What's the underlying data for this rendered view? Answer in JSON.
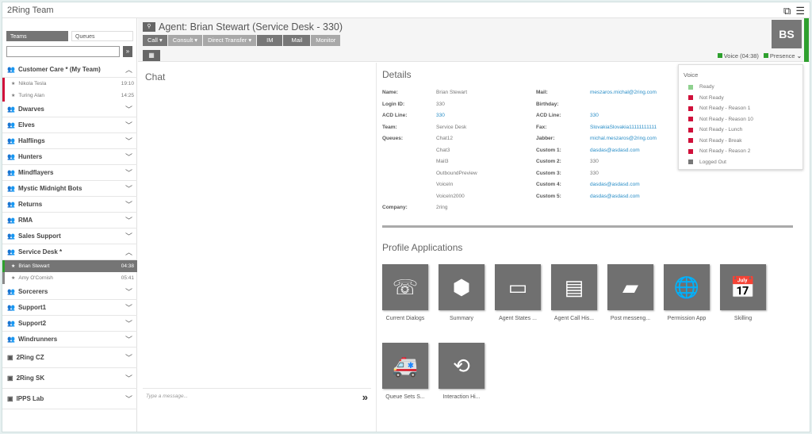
{
  "app": {
    "title": "2Ring Team"
  },
  "sidebar": {
    "tabs": [
      "Teams",
      "Queues"
    ],
    "search": {
      "value": "",
      "placeholder": ""
    },
    "groups": [
      {
        "name": "Customer Care * (My Team)",
        "expanded": true,
        "members": [
          {
            "name": "Nikola Tesla",
            "time": "19:10",
            "status": "#d0103a"
          },
          {
            "name": "Turing Alan",
            "time": "14:25",
            "status": "#d0103a"
          }
        ]
      },
      {
        "name": "Dwarves"
      },
      {
        "name": "Elves"
      },
      {
        "name": "Halflings"
      },
      {
        "name": "Hunters"
      },
      {
        "name": "Mindflayers"
      },
      {
        "name": "Mystic Midnight Bots"
      },
      {
        "name": "Returns"
      },
      {
        "name": "RMA"
      },
      {
        "name": "Sales Support"
      },
      {
        "name": "Service Desk *",
        "expanded": true,
        "members": [
          {
            "name": "Brian Stewart",
            "time": "04:38",
            "status": "#2ea02e",
            "selected": true
          },
          {
            "name": "Amy O'Cornish",
            "time": "05:41",
            "status": "#888888"
          }
        ]
      },
      {
        "name": "Sorcerers"
      },
      {
        "name": "Support1"
      },
      {
        "name": "Support2"
      },
      {
        "name": "Windrunners"
      },
      {
        "name": "2Ring CZ",
        "type": "contact"
      },
      {
        "name": "2Ring SK",
        "type": "contact"
      },
      {
        "name": "IPPS Lab",
        "type": "contact"
      }
    ]
  },
  "header": {
    "agent_title": "Agent: Brian Stewart (Service Desk - 330)",
    "buttons": {
      "call": "Call",
      "consult": "Consult",
      "direct_transfer": "Direct Transfer",
      "im": "IM",
      "mail": "Mail",
      "monitor": "Monitor"
    },
    "avatar": "BS",
    "voice_status": "Voice (04:38)",
    "presence": "Presence",
    "status_color": "#2ea02e"
  },
  "chat": {
    "title": "Chat",
    "placeholder": "Type a message..."
  },
  "details": {
    "title": "Details",
    "left": [
      {
        "k": "Name:",
        "v": [
          "Brian Stewart"
        ]
      },
      {
        "k": "Login ID:",
        "v": [
          "330"
        ]
      },
      {
        "k": "ACD Line:",
        "v": [
          "330"
        ],
        "link": true
      },
      {
        "k": "Team:",
        "v": [
          "Service Desk"
        ]
      },
      {
        "k": "Queues:",
        "v": [
          "Chat12",
          "Chat3",
          "Mail3",
          "OutboundPreview",
          "VoiceIn",
          "VoiceIn2000"
        ]
      },
      {
        "k": "Company:",
        "v": [
          "2ring"
        ]
      }
    ],
    "right": [
      {
        "k": "Mail:",
        "v": "meszaros.michal@2ring.com",
        "link": true
      },
      {
        "k": "Birthday:",
        "v": ""
      },
      {
        "k": "ACD Line:",
        "v": "330",
        "link": true
      },
      {
        "k": "Fax:",
        "v": "SlovakiaSlovakia11111111111",
        "link": true
      },
      {
        "k": "Jabber:",
        "v": "michal.meszaros@2ring.com",
        "link": true
      },
      {
        "k": "Custom 1:",
        "v": "dasdas@asdasd.com",
        "link": true
      },
      {
        "k": "Custom 2:",
        "v": "330"
      },
      {
        "k": "Custom 3:",
        "v": "330"
      },
      {
        "k": "Custom 4:",
        "v": "dasdas@asdasd.com",
        "link": true
      },
      {
        "k": "Custom 5:",
        "v": "dasdas@asdasd.com",
        "link": true
      }
    ]
  },
  "profile_apps": {
    "title": "Profile Applications",
    "apps": [
      {
        "label": "Current Dialogs",
        "icon": "☏"
      },
      {
        "label": "Summary",
        "icon": "⬢"
      },
      {
        "label": "Agent States ...",
        "icon": "▭"
      },
      {
        "label": "Agent Call His...",
        "icon": "▤"
      },
      {
        "label": "Post messeng...",
        "icon": "▰"
      },
      {
        "label": "Permission App",
        "icon": "🌐"
      },
      {
        "label": "Skilling",
        "icon": "📅"
      },
      {
        "label": "Queue Sets S...",
        "icon": "🚑"
      },
      {
        "label": "Interaction Hi...",
        "icon": "⟲"
      }
    ]
  },
  "presence_menu": {
    "title": "Voice",
    "items": [
      {
        "label": "Ready",
        "color": "#8fd18f"
      },
      {
        "label": "Not Ready",
        "color": "#d0103a"
      },
      {
        "label": "Not Ready - Reason 1",
        "color": "#d0103a"
      },
      {
        "label": "Not Ready - Reason 10",
        "color": "#d0103a"
      },
      {
        "label": "Not Ready - Lunch",
        "color": "#d0103a"
      },
      {
        "label": "Not Ready - Break",
        "color": "#d0103a"
      },
      {
        "label": "Not Ready - Reason 2",
        "color": "#d0103a"
      },
      {
        "label": "Logged Out",
        "color": "#777777"
      }
    ]
  }
}
